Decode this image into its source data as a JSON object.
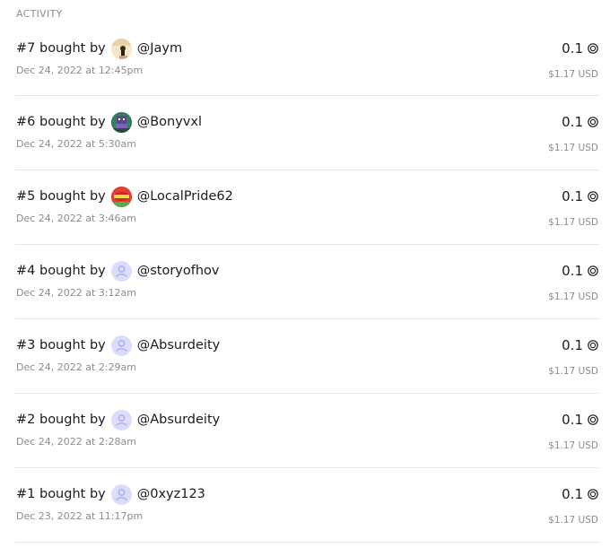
{
  "section": {
    "heading": "ACTIVITY"
  },
  "colors": {
    "text": "#1b1b1f",
    "muted": "#8a8d93",
    "divider": "#e6e6e9",
    "default_avatar_bg": "#dcdcfb",
    "default_avatar_fg": "#a9a9ec"
  },
  "activity": [
    {
      "title": "#7 bought by",
      "username": "@Jaym",
      "date": "Dec 24, 2022 at 12:45pm",
      "price": "0.1",
      "usd": "$1.17 USD",
      "avatar": "jaym-photo-avatar"
    },
    {
      "title": "#6 bought by",
      "username": "@Bonyvxl",
      "date": "Dec 24, 2022 at 5:30am",
      "price": "0.1",
      "usd": "$1.17 USD",
      "avatar": "bonyvxl-pixel-avatar"
    },
    {
      "title": "#5 bought by",
      "username": "@LocalPride62",
      "date": "Dec 24, 2022 at 3:46am",
      "price": "0.1",
      "usd": "$1.17 USD",
      "avatar": "localpride-red-avatar"
    },
    {
      "title": "#4 bought by",
      "username": "@storyofhov",
      "date": "Dec 24, 2022 at 3:12am",
      "price": "0.1",
      "usd": "$1.17 USD",
      "avatar": "default-user-avatar"
    },
    {
      "title": "#3 bought by",
      "username": "@Absurdeity",
      "date": "Dec 24, 2022 at 2:29am",
      "price": "0.1",
      "usd": "$1.17 USD",
      "avatar": "default-user-avatar"
    },
    {
      "title": "#2 bought by",
      "username": "@Absurdeity",
      "date": "Dec 24, 2022 at 2:28am",
      "price": "0.1",
      "usd": "$1.17 USD",
      "avatar": "default-user-avatar"
    },
    {
      "title": "#1 bought by",
      "username": "@0xyz123",
      "date": "Dec 23, 2022 at 11:17pm",
      "price": "0.1",
      "usd": "$1.17 USD",
      "avatar": "default-user-avatar"
    }
  ],
  "icons": {
    "currency": "coin-icon"
  }
}
